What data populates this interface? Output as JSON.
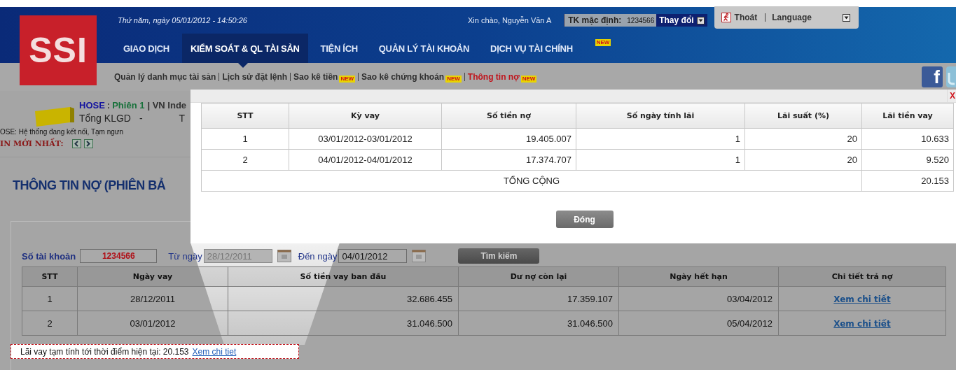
{
  "header": {
    "logo": "SSI",
    "datetime": "Thứ năm, ngày 05/01/2012 - 14:50:26",
    "greeting": "Xin chào, Nguyễn Văn A",
    "account_label": "TK mặc định:",
    "account_number": "1234566",
    "change_label": "Thay đổi",
    "logout": "Thoát",
    "language": "Language"
  },
  "nav": [
    {
      "label": "GIAO DỊCH",
      "selected": false
    },
    {
      "label": "KIỂM SOÁT & QL TÀI SẢN",
      "selected": true
    },
    {
      "label": "TIỆN ÍCH",
      "selected": false
    },
    {
      "label": "QUẢN LÝ TÀI KHOẢN",
      "selected": false
    },
    {
      "label": "DỊCH VỤ TÀI CHÍNH",
      "selected": false,
      "badge": "NEW"
    }
  ],
  "subnav": [
    {
      "label": "Quản lý danh mục tài sản",
      "selected": false
    },
    {
      "label": "Lịch sử đặt lệnh",
      "selected": false
    },
    {
      "label": "Sao kê tiền",
      "selected": false,
      "badge": "NEW"
    },
    {
      "label": "Sao kê chứng khoán",
      "selected": false,
      "badge": "NEW"
    },
    {
      "label": "Thông tin nợ",
      "selected": true,
      "badge": "NEW"
    }
  ],
  "social": {
    "facebook": "f"
  },
  "market": {
    "summary": [
      {
        "kind": "exchange",
        "text": "HOSE"
      },
      {
        "kind": "plain",
        "text": ":"
      },
      {
        "kind": "session",
        "text": "Phiên 1"
      },
      {
        "kind": "plain",
        "text": "| VN Inde"
      }
    ],
    "volume_label": "Tổng KLGD",
    "volume_value": "-",
    "cut_column": "T",
    "status": "OSE: Hệ thống đang kết nối, Tạm ngưn",
    "news_label": "IN MỚI NHẤT:"
  },
  "page_title": "THÔNG TIN NỢ (PHIÊN BẢ",
  "filter": {
    "account_label": "Số tài khoản",
    "account_value": "1234566",
    "from_label": "Từ ngày",
    "from_value": "28/12/2011",
    "from_disabled": true,
    "to_label": "Đến ngày",
    "to_value": "04/01/2012",
    "search_button": "Tìm kiếm"
  },
  "loans": {
    "columns": [
      "STT",
      "Ngày vay",
      "Số tiền vay ban đầu",
      "Dư nợ còn lại",
      "Ngày hết hạn",
      "Chi tiết trả nợ"
    ],
    "rows": [
      {
        "stt": "1",
        "date": "28/12/2011",
        "initial": "32.686.455",
        "remaining": "17.359.107",
        "due": "03/04/2012",
        "link": "Xem chi tiết"
      },
      {
        "stt": "2",
        "date": "03/01/2012",
        "initial": "31.046.500",
        "remaining": "31.046.500",
        "due": "05/04/2012",
        "link": "Xem chi tiết"
      }
    ]
  },
  "interest_note": {
    "text": "Lãi vay tạm tính tới thời điểm hiện tại: 20.153",
    "link": "Xem chi tiet"
  },
  "modal": {
    "close": "X",
    "columns": [
      "STT",
      "Kỳ vay",
      "Số tiền nợ",
      "Số ngày tính lãi",
      "Lãi suất (%)",
      "Lãi tiền vay"
    ],
    "rows": [
      [
        "1",
        "03/01/2012-03/01/2012",
        "19.405.007",
        "1",
        "20",
        "10.633"
      ],
      [
        "2",
        "04/01/2012-04/01/2012",
        "17.374.707",
        "1",
        "20",
        "9.520"
      ]
    ],
    "total_label": "TỔNG CỘNG",
    "total_value": "20.153",
    "button": "Đóng"
  }
}
